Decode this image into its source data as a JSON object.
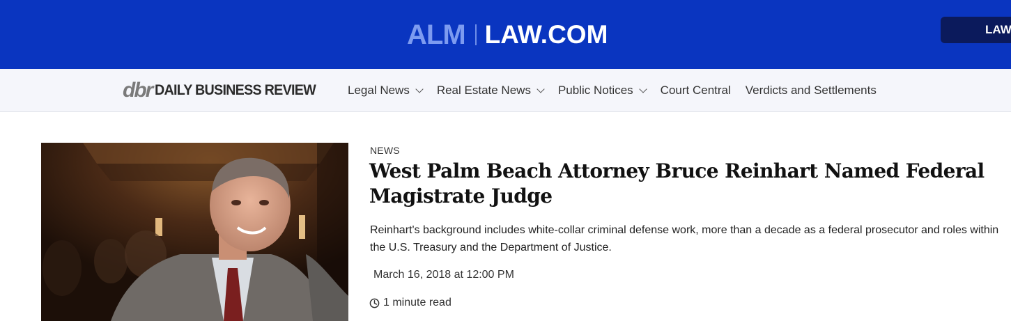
{
  "header": {
    "alm_logo": "ALM",
    "site_logo": "LAW.COM",
    "right_button_label": "LAW"
  },
  "nav": {
    "publication_mark": "dbr",
    "publication_name": "DAILY BUSINESS REVIEW",
    "items": [
      {
        "label": "Legal News",
        "has_dropdown": true
      },
      {
        "label": "Real Estate News",
        "has_dropdown": true
      },
      {
        "label": "Public Notices",
        "has_dropdown": true
      },
      {
        "label": "Court Central",
        "has_dropdown": false
      },
      {
        "label": "Verdicts and Settlements",
        "has_dropdown": false
      }
    ]
  },
  "article": {
    "category": "NEWS",
    "title": "West Palm Beach Attorney Bruce Reinhart Named Federal Magistrate Judge",
    "summary": "Reinhart's background includes white-collar criminal defense work, more than a decade as a federal prosecutor and roles within the U.S. Treasury and the Department of Justice.",
    "date": "March 16, 2018 at 12:00 PM",
    "read_time": "1 minute read",
    "read_time_icon": "clock-icon"
  },
  "colors": {
    "top_bar": "#0a35c0",
    "law_button": "#0b1a5c",
    "nav_bg": "#f5f6fb"
  }
}
